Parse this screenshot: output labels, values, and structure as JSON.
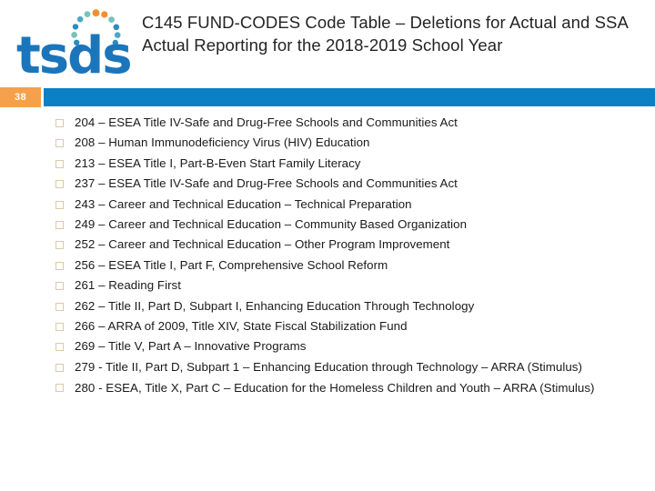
{
  "brand": {
    "wordmark": "tsds",
    "logo_blue": "#1b75bb",
    "dot_colors": [
      "#f0912d",
      "#4aa8c4",
      "#2b8cbe",
      "#7ac2b8",
      "#f0912d",
      "#4aa8c4",
      "#2b8cbe",
      "#7ac2b8",
      "#f0912d",
      "#2b8cbe"
    ]
  },
  "header": {
    "title": "C145 FUND-CODES Code Table – Deletions for Actual and SSA Actual Reporting  for the  2018-2019 School Year"
  },
  "accent": {
    "page_number": "38",
    "badge_color": "#f5a04b",
    "bar_color": "#0b80c4"
  },
  "body": {
    "bullet_glyph": "hollow-square",
    "items": [
      {
        "text": "204 – ESEA Title IV-Safe and Drug-Free Schools and Communities Act"
      },
      {
        "text": "208 – Human Immunodeficiency Virus (HIV) Education"
      },
      {
        "text": "213 – ESEA Title I, Part-B-Even Start Family Literacy"
      },
      {
        "text": "237 – ESEA Title IV-Safe and Drug-Free Schools and Communities Act"
      },
      {
        "text": "243 – Career and Technical Education – Technical Preparation"
      },
      {
        "text": "249 – Career and Technical Education – Community Based Organization"
      },
      {
        "text": "252 – Career and Technical Education – Other Program Improvement"
      },
      {
        "text": "256 – ESEA Title I, Part F, Comprehensive School Reform"
      },
      {
        "text": "261 – Reading First"
      },
      {
        "text": "262 – Title II, Part D, Subpart I, Enhancing Education Through Technology"
      },
      {
        "text": "266 – ARRA of 2009, Title XIV, State Fiscal Stabilization Fund"
      },
      {
        "text": "269 – Title V, Part A – Innovative Programs"
      },
      {
        "text": "279 - Title II, Part D, Subpart 1 – Enhancing Education through Technology – ARRA (Stimulus)"
      },
      {
        "text": "280 - ESEA, Title X, Part C – Education for the Homeless Children and Youth – ARRA (Stimulus)"
      }
    ]
  }
}
